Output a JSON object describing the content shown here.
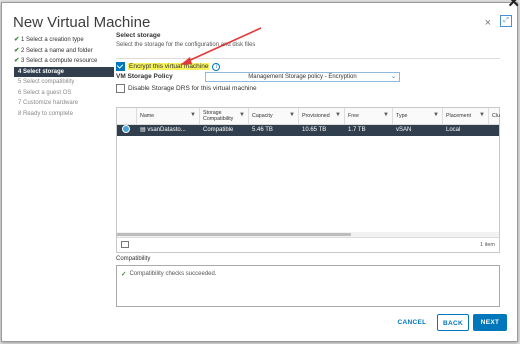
{
  "dialog": {
    "title": "New Virtual Machine",
    "close_icon": "×",
    "outer_close_icon": "✕",
    "expand_icon": "⤢"
  },
  "steps": [
    {
      "label": "1 Select a creation type",
      "state": "done"
    },
    {
      "label": "2 Select a name and folder",
      "state": "done"
    },
    {
      "label": "3 Select a compute resource",
      "state": "done"
    },
    {
      "label": "4 Select storage",
      "state": "active"
    },
    {
      "label": "5 Select compatibility",
      "state": "todo"
    },
    {
      "label": "6 Select a guest OS",
      "state": "todo"
    },
    {
      "label": "7 Customize hardware",
      "state": "todo"
    },
    {
      "label": "8 Ready to complete",
      "state": "todo"
    }
  ],
  "storage": {
    "title": "Select storage",
    "description": "Select the storage for the configuration and disk files",
    "encrypt_label": "Encrypt this virtual machine",
    "encrypt_checked": true,
    "policy_label": "VM Storage Policy",
    "policy_value": "Management Storage policy - Encryption",
    "drs_label": "Disable Storage DRS for this virtual machine",
    "drs_checked": false
  },
  "table": {
    "columns": [
      "",
      "Name",
      "Storage Compatibility",
      "Capacity",
      "Provisioned",
      "Free",
      "Type",
      "Placement",
      "Clu"
    ],
    "rows": [
      {
        "name": "vsanDatasto...",
        "compat": "Compatible",
        "capacity": "5.46 TB",
        "provisioned": "10.65 TB",
        "free": "1.7 TB",
        "type": "vSAN",
        "placement": "Local",
        "cluster": ""
      }
    ],
    "item_count": "1 item"
  },
  "compatibility": {
    "label": "Compatibility",
    "message": "Compatibility checks succeeded."
  },
  "buttons": {
    "cancel": "CANCEL",
    "back": "BACK",
    "next": "NEXT"
  },
  "colors": {
    "accent": "#0076bb",
    "selected_row": "#303e4d",
    "highlight": "#f6f25c",
    "success": "#3a8f34",
    "annotation_arrow": "#e03a3a"
  }
}
